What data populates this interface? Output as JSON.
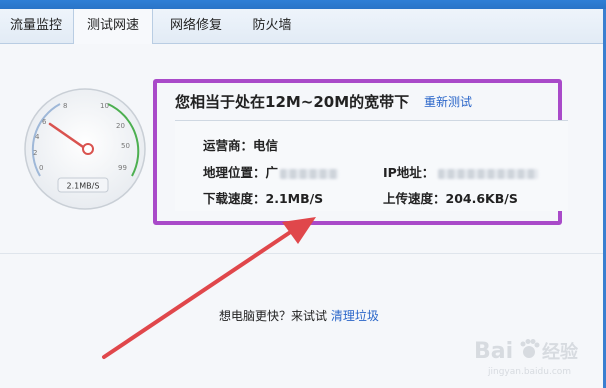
{
  "tabs": [
    {
      "label": "流量监控",
      "active": false
    },
    {
      "label": "测试网速",
      "active": true
    },
    {
      "label": "网络修复",
      "active": false
    },
    {
      "label": "防火墙",
      "active": false
    }
  ],
  "gauge": {
    "ticks": [
      "0",
      "2",
      "4",
      "6",
      "8",
      "10",
      "20",
      "50",
      "99"
    ],
    "reading": "2.1MB/S"
  },
  "result": {
    "summary": "您相当于处在12M~20M的宽带下",
    "retest_label": "重新测试",
    "isp_label": "运营商：电信",
    "location_label": "地理位置：广",
    "ip_label": "IP地址：",
    "download_label": "下载速度：2.1MB/S",
    "upload_label": "上传速度：204.6KB/S"
  },
  "promo": {
    "text": "想电脑更快？来试试",
    "link": "清理垃圾"
  },
  "watermark": {
    "brand": "Bai",
    "brand_suffix": "经验",
    "sub": "jingyan.baidu.com"
  },
  "colors": {
    "highlight": "#a94ac9",
    "arrow": "#e0474b",
    "link": "#2a66c9",
    "needle": "#d9534f",
    "gauge_green": "#4caf50"
  }
}
